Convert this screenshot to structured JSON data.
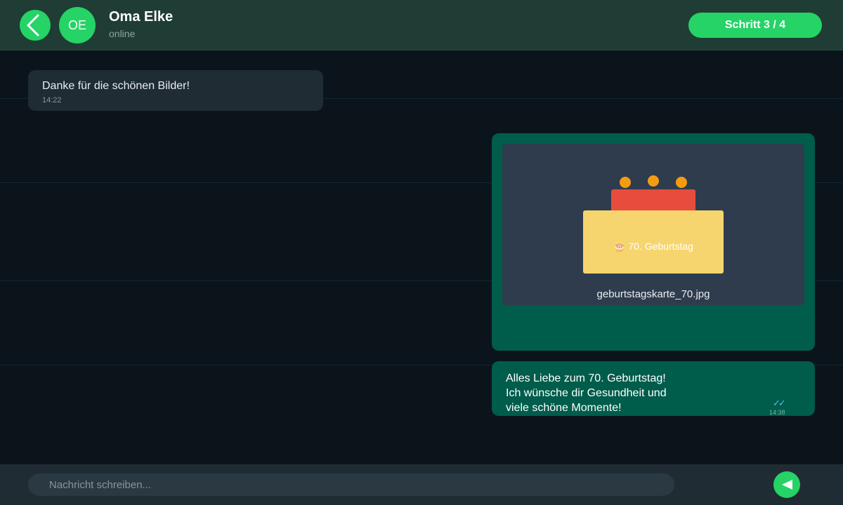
{
  "header": {
    "contact_initials": "OE",
    "contact_name": "Oma Elke",
    "contact_status": "online",
    "step_label": "Schritt 3 / 4",
    "back_icon": "chevron-left-icon"
  },
  "messages": [
    {
      "direction": "incoming",
      "text": "Danke für die schönen Bilder!",
      "time": "14:22"
    },
    {
      "direction": "outgoing",
      "type": "image",
      "card_label": "🎂 70. Geburtstag",
      "file_name": "geburtstagskarte_70.jpg"
    },
    {
      "direction": "outgoing",
      "type": "text",
      "lines": [
        "Alles Liebe zum 70. Geburtstag!",
        "Ich wünsche dir Gesundheit und",
        "viele schöne Momente!"
      ],
      "ticks": "✓✓",
      "time": "14:38"
    }
  ],
  "composer": {
    "placeholder": "Nachricht schreiben...",
    "send_icon": "send-icon"
  },
  "colors": {
    "accent": "#25d366",
    "header_bg": "#1f3d34",
    "chat_bg": "#0b141b",
    "incoming_bubble": "#1f2c34",
    "outgoing_bubble": "#005c4b",
    "image_card_bg": "#2e3c4e",
    "cake_body": "#f7d56e",
    "cake_top": "#e74c3c",
    "candle_flame": "#f39c12",
    "read_ticks": "#53bdeb"
  }
}
